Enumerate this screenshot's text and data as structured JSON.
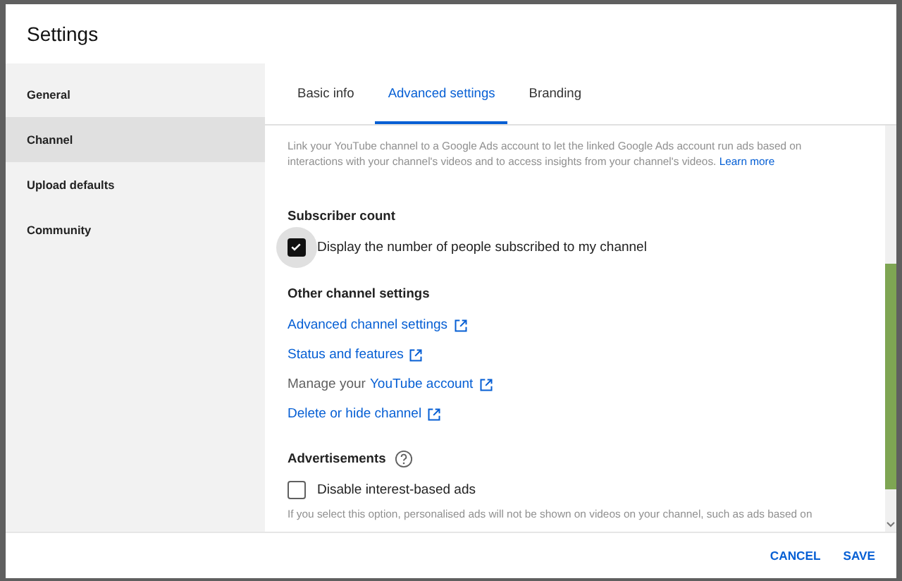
{
  "dialog": {
    "title": "Settings"
  },
  "sidebar": {
    "items": [
      {
        "label": "General",
        "selected": false
      },
      {
        "label": "Channel",
        "selected": true
      },
      {
        "label": "Upload defaults",
        "selected": false
      },
      {
        "label": "Community",
        "selected": false
      }
    ]
  },
  "tabs": [
    {
      "label": "Basic info",
      "selected": false
    },
    {
      "label": "Advanced settings",
      "selected": true
    },
    {
      "label": "Branding",
      "selected": false
    }
  ],
  "intro": {
    "text": "Link your YouTube channel to a Google Ads account to let the linked Google Ads account run ads based on interactions with your channel's videos and to access insights from your channel's videos.",
    "link": "Learn more"
  },
  "sections": [
    {
      "heading": "Subscriber count",
      "help": false,
      "items": [
        {
          "kind": "checkbox",
          "label": "Display the number of people subscribed to my channel",
          "checked": true,
          "focused": true
        }
      ]
    },
    {
      "heading": "Other channel settings",
      "help": false,
      "items": [
        {
          "kind": "link",
          "label": "Advanced channel settings"
        },
        {
          "kind": "link",
          "label": "Status and features"
        },
        {
          "kind": "link",
          "prefix": "Manage your",
          "label": "YouTube account"
        },
        {
          "kind": "link",
          "label": "Delete or hide channel"
        }
      ]
    },
    {
      "heading": "Advertisements",
      "help": true,
      "items": [
        {
          "kind": "checkbox",
          "label": "Disable interest-based ads",
          "checked": false,
          "focused": false
        },
        {
          "kind": "note",
          "text": "If you select this option, personalised ads will not be shown on videos on your channel, such as ads based on"
        }
      ]
    }
  ],
  "footer": {
    "buttons": [
      "CANCEL",
      "SAVE"
    ]
  }
}
